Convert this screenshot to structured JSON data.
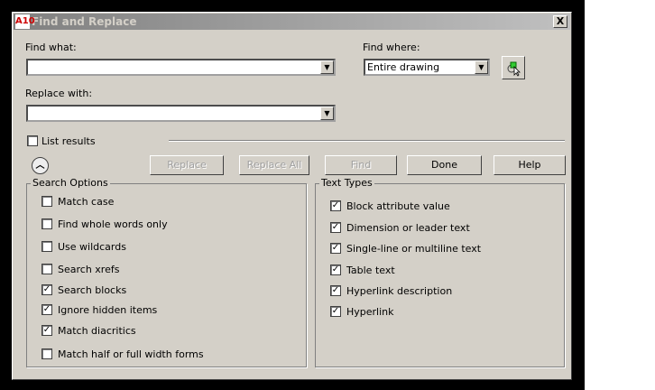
{
  "dialog": {
    "title": "Find and Replace",
    "app_icon": "A10",
    "close": "X"
  },
  "find_what": {
    "label": "Find what:",
    "value": ""
  },
  "find_where": {
    "label": "Find where:",
    "value": "Entire drawing"
  },
  "replace_with": {
    "label": "Replace with:",
    "value": ""
  },
  "list_results": {
    "label": "List results",
    "checked": false
  },
  "buttons": {
    "replace": "Replace",
    "replace_all": "Replace All",
    "find": "Find",
    "done": "Done",
    "help": "Help"
  },
  "search_options": {
    "title": "Search Options",
    "items": [
      {
        "label": "Match case",
        "checked": false
      },
      {
        "label": "Find whole words only",
        "checked": false
      },
      {
        "label": "Use wildcards",
        "checked": false
      },
      {
        "label": "Search xrefs",
        "checked": false
      },
      {
        "label": "Search blocks",
        "checked": true
      },
      {
        "label": "Ignore hidden items",
        "checked": true
      },
      {
        "label": "Match diacritics",
        "checked": true
      },
      {
        "label": "Match half or full width forms",
        "checked": false
      }
    ]
  },
  "text_types": {
    "title": "Text Types",
    "items": [
      {
        "label": "Block attribute value",
        "checked": true
      },
      {
        "label": "Dimension or leader text",
        "checked": true
      },
      {
        "label": "Single-line or multiline text",
        "checked": true
      },
      {
        "label": "Table text",
        "checked": true
      },
      {
        "label": "Hyperlink description",
        "checked": true
      },
      {
        "label": "Hyperlink",
        "checked": true
      }
    ]
  }
}
